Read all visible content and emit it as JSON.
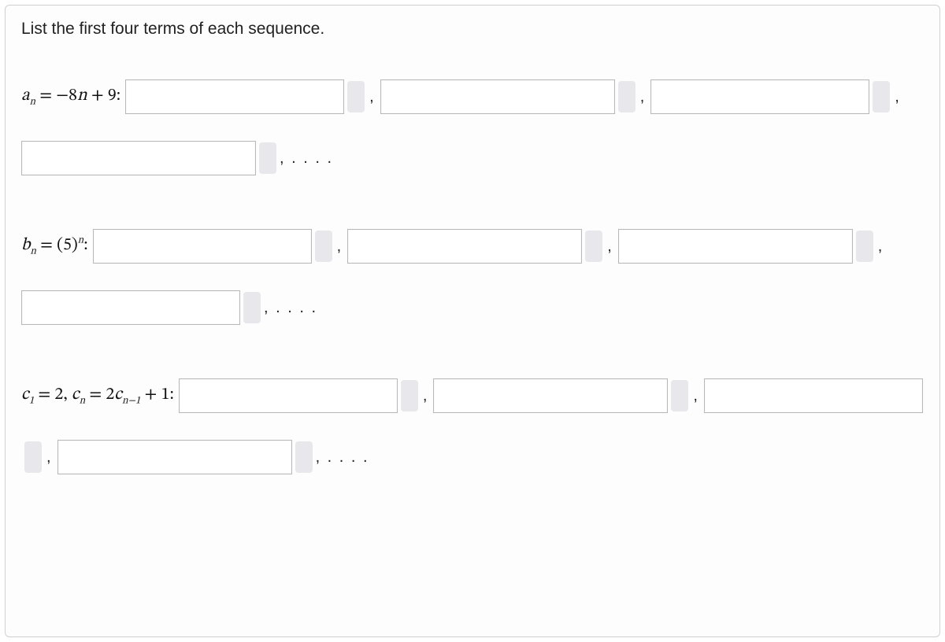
{
  "prompt": "List the first four terms of each sequence.",
  "sequences": {
    "a": {
      "formula_html": "<span class='ital'>a</span><span class='sub'>n</span> = −8<span class='ital'>n</span> + 9:"
    },
    "b": {
      "formula_html": "<span class='ital'>b</span><span class='sub'>n</span> = (5)<span class='sup'>n</span>:"
    },
    "c": {
      "formula_html": "<span class='ital'>c</span><span class='sub'>1</span> = 2, <span class='ital'>c</span><span class='sub'>n</span> = 2<span class='ital'>c</span><span class='sub'>n−1</span> + 1:"
    }
  },
  "separators": {
    "comma": ",",
    "dots": ", . . . ."
  }
}
